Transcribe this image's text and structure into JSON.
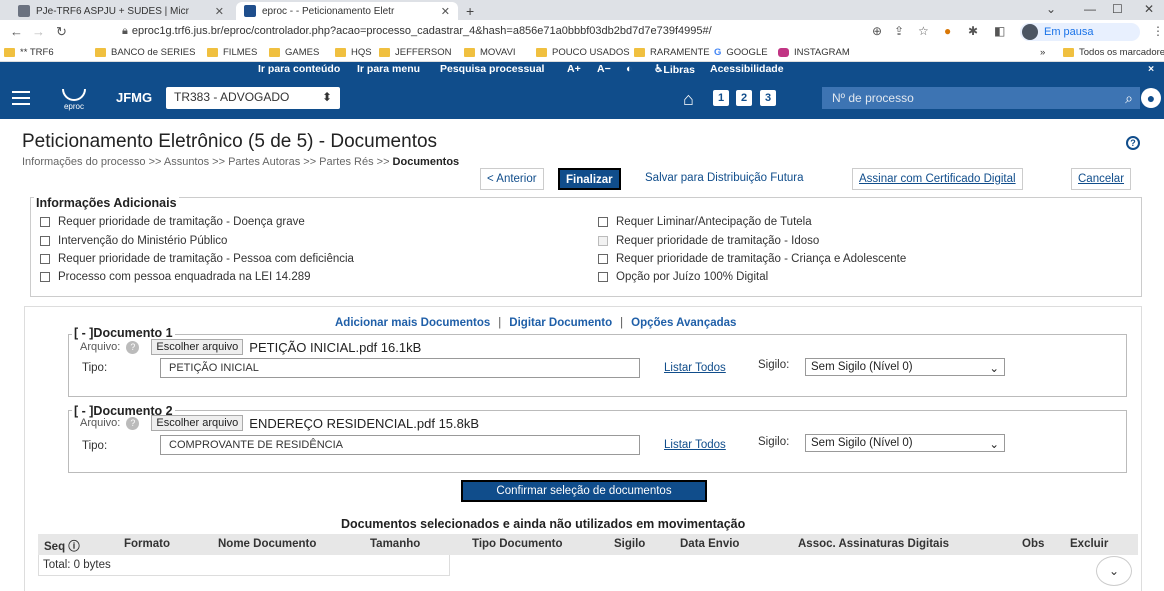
{
  "browser": {
    "tabs": [
      {
        "title": "PJe-TRF6 ASPJU + SUDES | Micr",
        "favicon_color": "#6b7280"
      },
      {
        "title": "eproc - - Peticionamento Eletr",
        "favicon_color": "#1f4e8c"
      }
    ],
    "url": "eproc1g.trf6.jus.br/eproc/controlador.php?acao=processo_cadastrar_4&hash=a856e71a0bbbf03db2bd7d7e739f4995#/",
    "profile_label": "Em pausa",
    "bookmarks": [
      "** TRF6",
      "BANCO de SERIES",
      "FILMES",
      "GAMES",
      "HQS",
      "JEFFERSON",
      "MOVAVI",
      "POUCO USADOS",
      "RARAMENTE",
      "GOOGLE",
      "INSTAGRAM"
    ],
    "more_bookmarks": "»",
    "all_bookmarks": "Todos os marcadores"
  },
  "accessibility": {
    "items": [
      "Ir para conteúdo",
      "Ir para menu",
      "Pesquisa processual",
      "A+",
      "A−",
      "◐",
      "Libras",
      "Acessibilidade"
    ],
    "close": "×"
  },
  "header": {
    "logo_text": "eproc",
    "org": "JFMG",
    "profile": "TR383 - ADVOGADO",
    "buttons": [
      "1",
      "2",
      "3"
    ],
    "process_placeholder": "Nº de processo"
  },
  "page": {
    "title": "Peticionamento Eletrônico (5 de 5) - Documentos",
    "breadcrumb_prefix": "Informações do processo >> Assuntos >> Partes Autoras >> Partes Rés >> ",
    "breadcrumb_current": "Documentos",
    "actions": {
      "previous": "< Anterior",
      "finish": "Finalizar",
      "save_future": "Salvar para Distribuição Futura",
      "sign": "Assinar com Certificado Digital",
      "cancel": "Cancelar"
    }
  },
  "info": {
    "heading": "Informações Adicionais",
    "left": [
      "Requer prioridade de tramitação - Doença grave",
      "Intervenção do Ministério Público",
      "Requer prioridade de tramitação - Pessoa com deficiência",
      "Processo com pessoa enquadrada na LEI 14.289"
    ],
    "right": [
      "Requer Liminar/Antecipação de Tutela",
      "Requer prioridade de tramitação - Idoso",
      "Requer prioridade de tramitação - Criança e Adolescente",
      "Opção por Juízo 100% Digital"
    ]
  },
  "doc_links": {
    "add": "Adicionar mais Documentos",
    "sep1": "|",
    "digitar": "Digitar Documento",
    "sep2": "|",
    "options": "Opções Avançadas"
  },
  "documents": [
    {
      "label": "[ - ]Documento 1",
      "arquivo": "Arquivo:",
      "choose": "Escolher arquivo",
      "file": "PETIÇÃO INICIAL.pdf 16.1kB",
      "tipo_label": "Tipo:",
      "tipo": "PETIÇÃO INICIAL",
      "listar": "Listar Todos",
      "sigilo_label": "Sigilo:",
      "sigilo": "Sem Sigilo (Nível 0)"
    },
    {
      "label": "[ - ]Documento 2",
      "arquivo": "Arquivo:",
      "choose": "Escolher arquivo",
      "file": "ENDEREÇO RESIDENCIAL.pdf 15.8kB",
      "tipo_label": "Tipo:",
      "tipo": "COMPROVANTE DE RESIDÊNCIA",
      "listar": "Listar Todos",
      "sigilo_label": "Sigilo:",
      "sigilo": "Sem Sigilo (Nível 0)"
    }
  ],
  "confirm": "Confirmar seleção de documentos",
  "selected": {
    "title": "Documentos selecionados e ainda não utilizados em movimentação",
    "columns": [
      "Seq",
      "Formato",
      "Nome Documento",
      "Tamanho",
      "Tipo Documento",
      "Sigilo",
      "Data Envio",
      "Assoc. Assinaturas Digitais",
      "Obs",
      "Excluir"
    ],
    "total": "Total: 0 bytes"
  }
}
